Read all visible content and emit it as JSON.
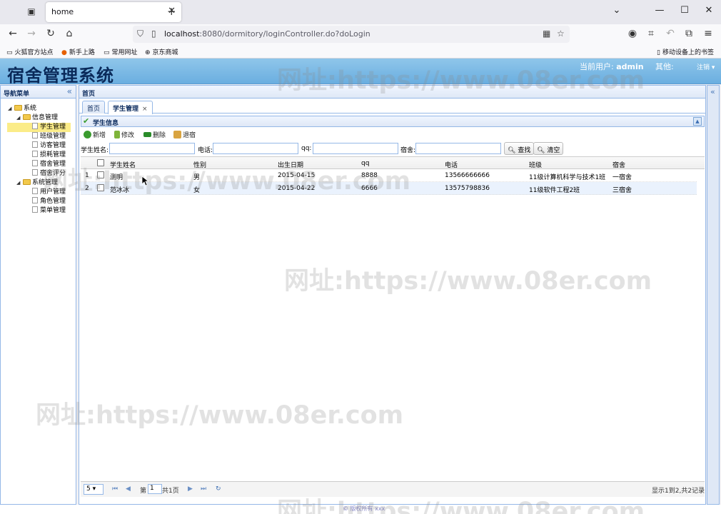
{
  "browser": {
    "tab_title": "home",
    "url_host": "localhost",
    "url_rest": ":8080/dormitory/loginController.do?doLogin",
    "bookmarks": [
      "火狐官方站点",
      "新手上路",
      "常用网址",
      "京东商城"
    ],
    "mobile_bookmarks": "移动设备上的书签"
  },
  "header": {
    "title": "宿舍管理系统",
    "user_label": "当前用户:",
    "user_name": "admin",
    "theme_label": "其他:",
    "logout": "注销"
  },
  "watermarks": [
    "网址:https://www.08er.com",
    "网址:https://www.08er.com",
    "网址:https://www.08er.com",
    "网址:https://www.08er.com",
    "网址:https://www.08er.com"
  ],
  "sidebar": {
    "title": "导航菜单",
    "collapse": "«",
    "tree": {
      "root": "系统",
      "info_group": "信息管理",
      "info_items": [
        "学生管理",
        "班级管理",
        "访客管理",
        "损耗管理",
        "宿舍管理",
        "宿舍评分"
      ],
      "sys_group": "系统管理",
      "sys_items": [
        "用户管理",
        "角色管理",
        "菜单管理"
      ]
    }
  },
  "main": {
    "title": "首页",
    "tabs": [
      {
        "label": "首页"
      },
      {
        "label": "学生管理",
        "close": "×"
      }
    ],
    "panel_title": "学生信息",
    "toolbar": {
      "add": "新增",
      "edit": "修改",
      "delete": "删除",
      "checkout": "退宿"
    },
    "search": {
      "name_label": "学生姓名:",
      "phone_label": "电话:",
      "qq_label": "qq:",
      "dorm_label": "宿舍:",
      "find": "查找",
      "clear": "清空"
    },
    "grid": {
      "columns": [
        "学生姓名",
        "性别",
        "出生日期",
        "qq",
        "电话",
        "班级",
        "宿舍"
      ],
      "rows": [
        {
          "num": "1",
          "name": "测明",
          "sex": "男",
          "birth": "2015-04-15",
          "qq": "8888",
          "phone": "13566666666",
          "class": "11级计算机科学与技术1班",
          "dorm": "一宿舍"
        },
        {
          "num": "2",
          "name": "范冰冰",
          "sex": "女",
          "birth": "2015-04-22",
          "qq": "6666",
          "phone": "13575798836",
          "class": "11级软件工程2班",
          "dorm": "三宿舍"
        }
      ]
    },
    "pager": {
      "page_size": "5",
      "page_label": "第",
      "page_value": "1",
      "total_pages": "共1页",
      "summary": "显示1到2,共2记录"
    }
  },
  "footer": {
    "text": "© 版权所有 xxx"
  }
}
